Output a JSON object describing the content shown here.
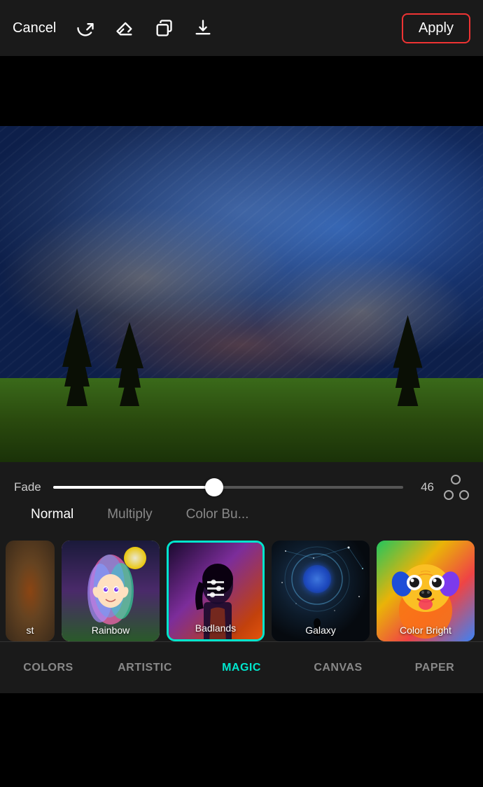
{
  "topbar": {
    "cancel_label": "Cancel",
    "apply_label": "Apply"
  },
  "controls": {
    "fade_label": "Fade",
    "fade_value": "46",
    "fade_percent": 46
  },
  "blend_modes": [
    {
      "id": "normal",
      "label": "Normal",
      "active": true
    },
    {
      "id": "multiply",
      "label": "Multiply",
      "active": false
    },
    {
      "id": "color_burn",
      "label": "Color Bu...",
      "active": false
    }
  ],
  "filters": [
    {
      "id": "first",
      "label": "st",
      "selected": false,
      "thumb_class": "thumb-first"
    },
    {
      "id": "rainbow",
      "label": "Rainbow",
      "selected": false,
      "thumb_class": "thumb-rainbow"
    },
    {
      "id": "badlands",
      "label": "Badlands",
      "selected": true,
      "thumb_class": "thumb-badlands"
    },
    {
      "id": "galaxy",
      "label": "Galaxy",
      "selected": false,
      "thumb_class": "thumb-galaxy"
    },
    {
      "id": "color_bright",
      "label": "Color Bright",
      "selected": false,
      "thumb_class": "thumb-colorbright"
    }
  ],
  "bottom_nav": [
    {
      "id": "colors",
      "label": "COLORS",
      "active": false
    },
    {
      "id": "artistic",
      "label": "ARTISTIC",
      "active": false
    },
    {
      "id": "magic",
      "label": "MAGIC",
      "active": true
    },
    {
      "id": "canvas",
      "label": "CANVAS",
      "active": false
    },
    {
      "id": "paper",
      "label": "PAPER",
      "active": false
    }
  ]
}
